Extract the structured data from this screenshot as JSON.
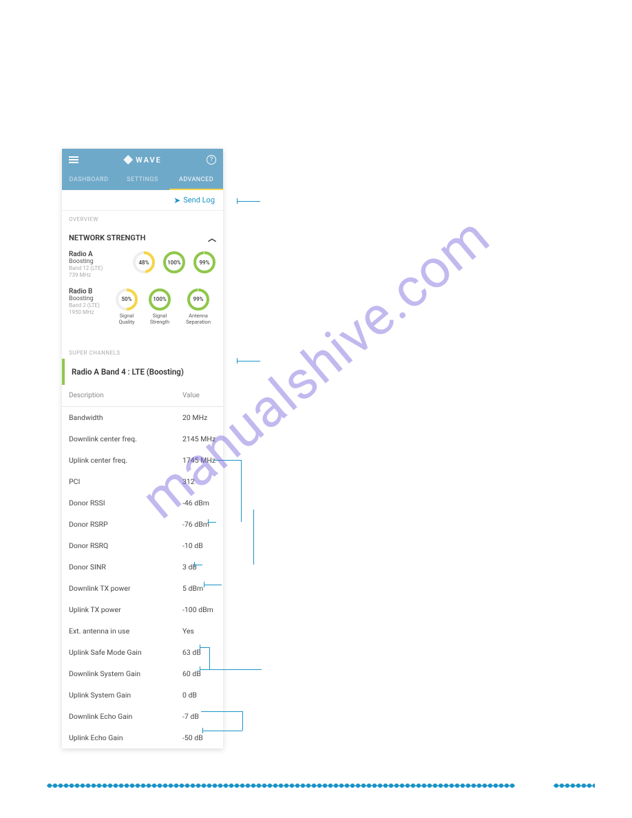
{
  "watermark": "manualshive.com",
  "header": {
    "brand": "WAVE",
    "help_symbol": "?"
  },
  "tabs": {
    "dashboard": "DASHBOARD",
    "settings": "SETTINGS",
    "advanced": "ADVANCED"
  },
  "sendlog_label": "Send Log",
  "sections": {
    "overview": "OVERVIEW",
    "super_channels": "SUPER CHANNELS"
  },
  "network_strength": {
    "title": "NETWORK STRENGTH",
    "radios": [
      {
        "name": "Radio A",
        "status": "Boosting",
        "band": "Band 12 (LTE)",
        "freq": "739 MHz",
        "gauges": {
          "quality": "48%",
          "strength": "100%",
          "separation": "99%"
        }
      },
      {
        "name": "Radio B",
        "status": "Boosting",
        "band": "Band 2 (LTE)",
        "freq": "1950 MHz",
        "gauges": {
          "quality": "50%",
          "strength": "100%",
          "separation": "99%"
        }
      }
    ],
    "gauge_labels": {
      "quality": "Signal\nQuality",
      "strength": "Signal\nStrength",
      "separation": "Antenna\nSeparation"
    }
  },
  "channel": {
    "title": "Radio A Band 4 : LTE (Boosting)",
    "headers": {
      "desc": "Description",
      "val": "Value"
    },
    "rows": [
      {
        "desc": "Bandwidth",
        "val": "20 MHz"
      },
      {
        "desc": "Downlink center freq.",
        "val": "2145 MHz"
      },
      {
        "desc": "Uplink center freq.",
        "val": "1745 MHz"
      },
      {
        "desc": "PCI",
        "val": "312"
      },
      {
        "desc": "Donor RSSI",
        "val": "-46 dBm"
      },
      {
        "desc": "Donor RSRP",
        "val": "-76 dBm"
      },
      {
        "desc": "Donor RSRQ",
        "val": "-10 dB"
      },
      {
        "desc": "Donor SINR",
        "val": "3 dB"
      },
      {
        "desc": "Downlink TX power",
        "val": "5 dBm"
      },
      {
        "desc": "Uplink TX power",
        "val": "-100 dBm"
      },
      {
        "desc": "Ext. antenna in use",
        "val": "Yes"
      },
      {
        "desc": "Uplink Safe Mode Gain",
        "val": "63 dB"
      },
      {
        "desc": "Downlink System Gain",
        "val": "60 dB"
      },
      {
        "desc": "Uplink System Gain",
        "val": "0 dB"
      },
      {
        "desc": "Downlink Echo Gain",
        "val": "-7 dB"
      },
      {
        "desc": "Uplink Echo Gain",
        "val": "-50 dB"
      }
    ]
  }
}
